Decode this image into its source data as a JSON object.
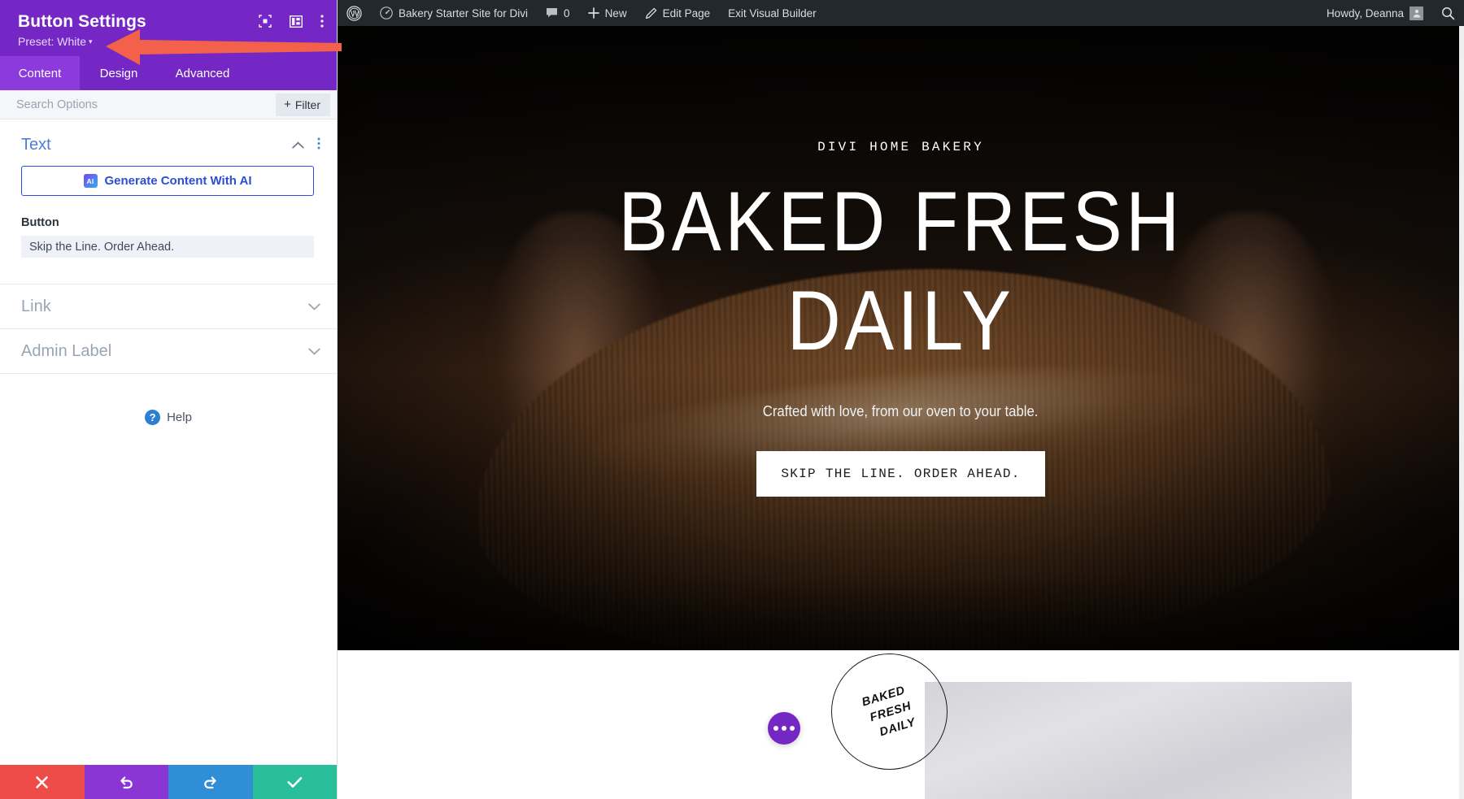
{
  "settings_panel": {
    "title": "Button Settings",
    "preset_label": "Preset: White",
    "preset_caret": "▾",
    "icons": {
      "focus": "focus-target-icon",
      "layout": "layout-panel-icon",
      "more": "vertical-dots-icon"
    },
    "tabs": [
      {
        "label": "Content",
        "active": true
      },
      {
        "label": "Design",
        "active": false
      },
      {
        "label": "Advanced",
        "active": false
      }
    ],
    "search": {
      "placeholder": "Search Options",
      "value": ""
    },
    "filter_button": {
      "plus": "+",
      "label": "Filter"
    },
    "sections": [
      {
        "title": "Text",
        "expanded": true,
        "ai_button": {
          "badge": "AI",
          "label": "Generate Content With AI"
        },
        "fields": [
          {
            "label": "Button",
            "value": "Skip the Line. Order Ahead."
          }
        ]
      },
      {
        "title": "Link",
        "expanded": false
      },
      {
        "title": "Admin Label",
        "expanded": false
      }
    ],
    "help": {
      "icon": "?",
      "label": "Help"
    },
    "actions": [
      {
        "name": "cancel",
        "glyph": "✖",
        "color": "#ee4c48"
      },
      {
        "name": "undo",
        "glyph": "↺",
        "color": "#8b35d4"
      },
      {
        "name": "redo",
        "glyph": "↻",
        "color": "#2f8ed6"
      },
      {
        "name": "save",
        "glyph": "✔",
        "color": "#29bf9a"
      }
    ],
    "colors": {
      "header_purple": "#7427c4",
      "tab_active": "#8c3ade",
      "section_blue": "#4c7fd4",
      "ai_blue": "#2b4dd8",
      "annotation_orange": "#f4614a"
    }
  },
  "admin_bar": {
    "wp_logo": "wordpress-logo-icon",
    "site_icon": "dashboard-icon",
    "site_name": "Bakery Starter Site for Divi",
    "comments_icon": "comment-bubble-icon",
    "comments_count": "0",
    "new_plus": "+",
    "new_label": "New",
    "edit_icon": "pencil-icon",
    "edit_label": "Edit Page",
    "exit_label": "Exit Visual Builder",
    "greeting": "Howdy, Deanna",
    "avatar": "user-avatar",
    "search_icon": "search-icon"
  },
  "hero": {
    "eyebrow": "DIVI HOME BAKERY",
    "headline_line1": "BAKED FRESH",
    "headline_line2": "DAILY",
    "subhead": "Crafted with love, from our oven to your table.",
    "cta_label": "SKIP THE LINE. ORDER AHEAD."
  },
  "lower_section": {
    "stamp": {
      "line1": "BAKED",
      "line2": "FRESH",
      "line3": "DAILY"
    },
    "fab": "more-options-fab"
  }
}
